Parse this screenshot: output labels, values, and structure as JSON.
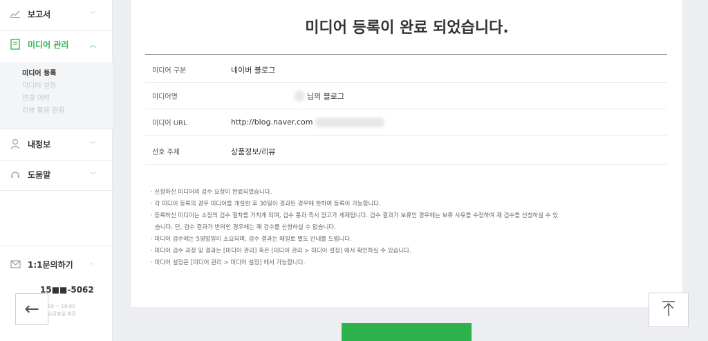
{
  "sidebar": {
    "menu": [
      {
        "label": "보고서",
        "icon": "chart-line-icon"
      },
      {
        "label": "미디어 관리",
        "icon": "document-icon"
      },
      {
        "label": "내정보",
        "icon": "user-icon"
      },
      {
        "label": "도움말",
        "icon": "headset-icon"
      }
    ],
    "submenu": [
      "미디어 등록",
      "미디어 설정",
      "변경 이력",
      "리뷰 활용 현황"
    ],
    "inquiry_label": "1:1문의하기",
    "phone": "15■■-5062",
    "hours": [
      "10:00 ~ 18:00",
      "토/일/공휴일 휴무"
    ]
  },
  "main": {
    "title": "미디어 등록이 완료 되었습니다.",
    "rows": [
      {
        "key": "미디어 구분",
        "value": "네이버 블로그"
      },
      {
        "key": "미디어명",
        "value": "님의 블로그"
      },
      {
        "key": "미디어 URL",
        "value": "http://blog.naver.com"
      },
      {
        "key": "선호 주제",
        "value": "상품정보/리뷰"
      }
    ],
    "notes": [
      "· 신청하신 미디어의 검수 요청이 완료되었습니다.",
      "· 각 미디어 등록의 경우 미디어를 개설한 후 30일이 경과된 경우에 한하여 등록이 가능합니다.",
      "· 등록하신 미디어는 소정의 검수 절차를 거치게 되며, 검수 통과 즉시 광고가 게재됩니다. 검수 결과가 보류인 경우에는 보류 사유를 수정하여 재 검수를 신청하실 수 있",
      "  습니다. 단, 검수 결과가 반려인 경우에는 재 검수를 신청하실 수 없습니다.",
      "· 미디어 검수에는 5영업일이 소요되며, 검수 결과는 메일로 별도 안내를 드립니다.",
      "· 미디어 검수 과정 및 결과는 [미디어 관리] 혹은 [미디어 관리 > 미디어 설정] 에서 확인하실 수 있습니다.",
      "· 미디어 설정은 [미디어 관리 > 미디어 설정] 에서 가능합니다."
    ]
  },
  "colors": {
    "accent": "#2eb24c"
  }
}
